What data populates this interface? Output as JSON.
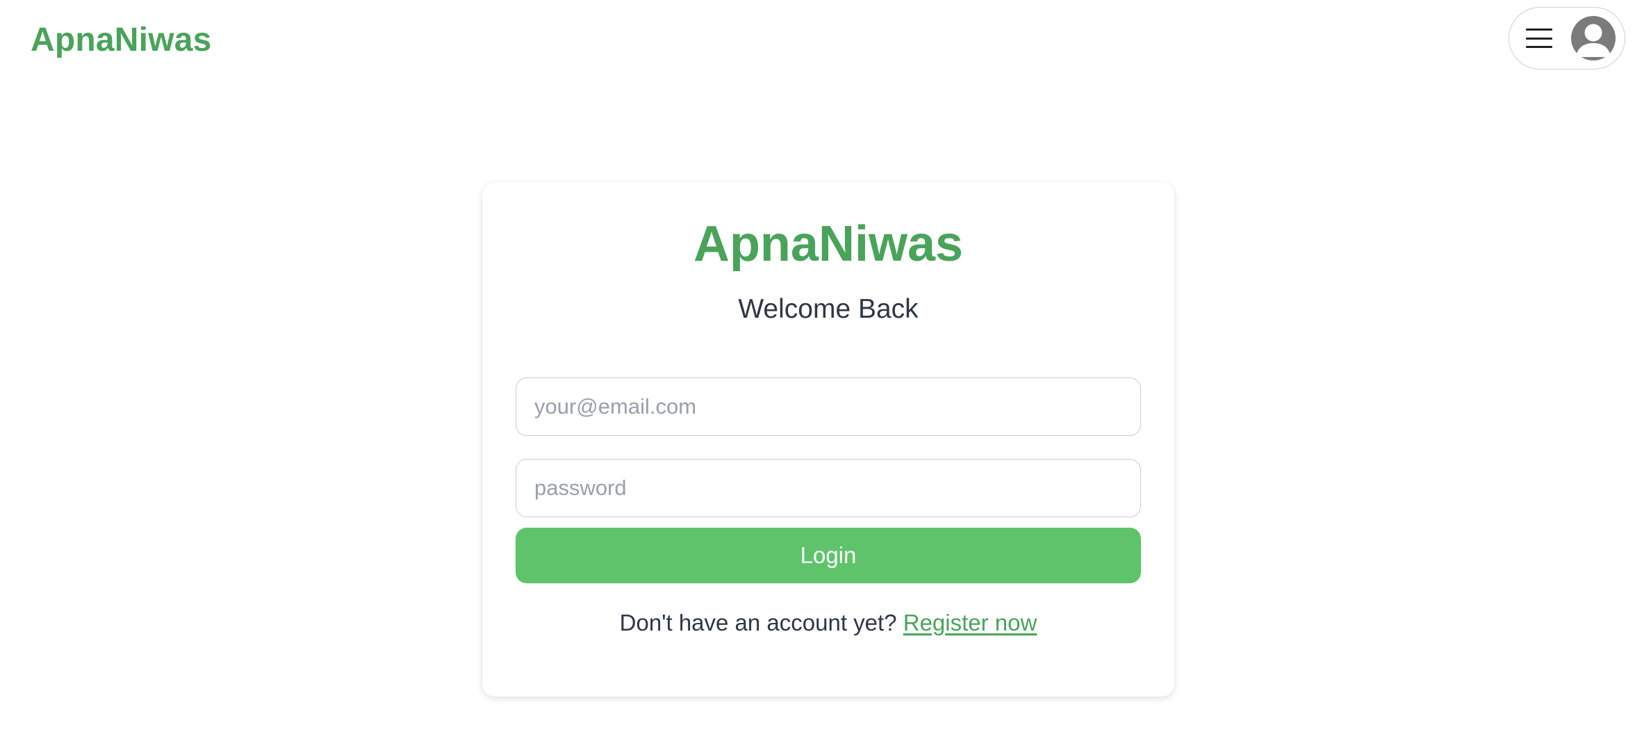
{
  "header": {
    "brand": "ApnaNiwas",
    "menu_icon": "hamburger-icon",
    "avatar_icon": "user-avatar-icon"
  },
  "login_card": {
    "title": "ApnaNiwas",
    "subtitle": "Welcome Back",
    "email": {
      "value": "",
      "placeholder": "your@email.com"
    },
    "password": {
      "value": "",
      "placeholder": "password"
    },
    "login_label": "Login",
    "register_prompt": "Don't have an account yet?",
    "register_link": "Register now"
  },
  "colors": {
    "brand": "#4aa35a",
    "button": "#5fc36b",
    "text": "#2f3644",
    "placeholder": "#9aa0aa"
  }
}
